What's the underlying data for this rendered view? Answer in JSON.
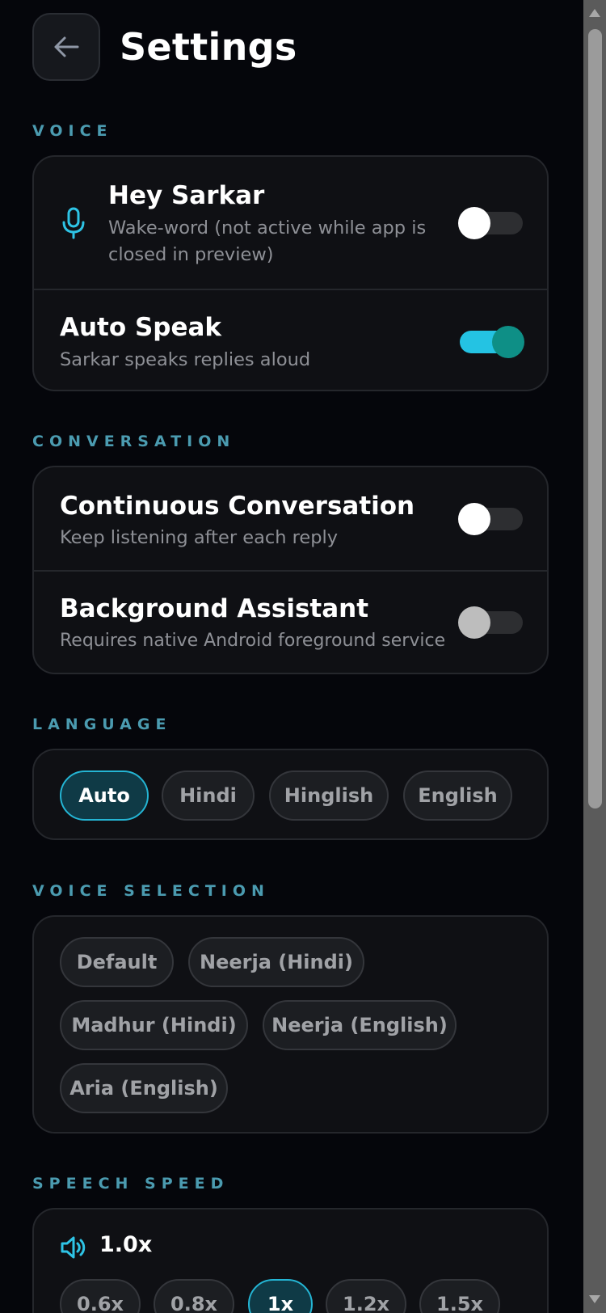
{
  "header": {
    "title": "Settings"
  },
  "sections": {
    "voice": {
      "label": "VOICE",
      "hey_sarkar": {
        "title": "Hey Sarkar",
        "subtitle_line1": "Wake-word (not active while app is",
        "subtitle_line2": "closed in preview)",
        "enabled": false
      },
      "auto_speak": {
        "title": "Auto Speak",
        "subtitle": "Sarkar speaks replies aloud",
        "enabled": true
      }
    },
    "conversation": {
      "label": "CONVERSATION",
      "continuous": {
        "title": "Continuous Conversation",
        "subtitle": "Keep listening after each reply",
        "enabled": false
      },
      "background": {
        "title": "Background Assistant",
        "subtitle": "Requires native Android foreground service",
        "enabled": false
      }
    },
    "language": {
      "label": "LANGUAGE",
      "options": [
        "Auto",
        "Hindi",
        "Hinglish",
        "English"
      ],
      "selected": "Auto"
    },
    "voice_selection": {
      "label": "VOICE SELECTION",
      "options": [
        "Default",
        "Neerja (Hindi)",
        "Madhur (Hindi)",
        "Neerja (English)",
        "Aria (English)"
      ]
    },
    "speech_speed": {
      "label": "SPEECH SPEED",
      "current": "1.0x",
      "options": [
        "0.6x",
        "0.8x",
        "1x",
        "1.2x",
        "1.5x"
      ],
      "selected": "1x"
    }
  },
  "colors": {
    "accent": "#24c3e3",
    "section_label": "#4b9bb0",
    "knob_on": "#0e8f86"
  }
}
